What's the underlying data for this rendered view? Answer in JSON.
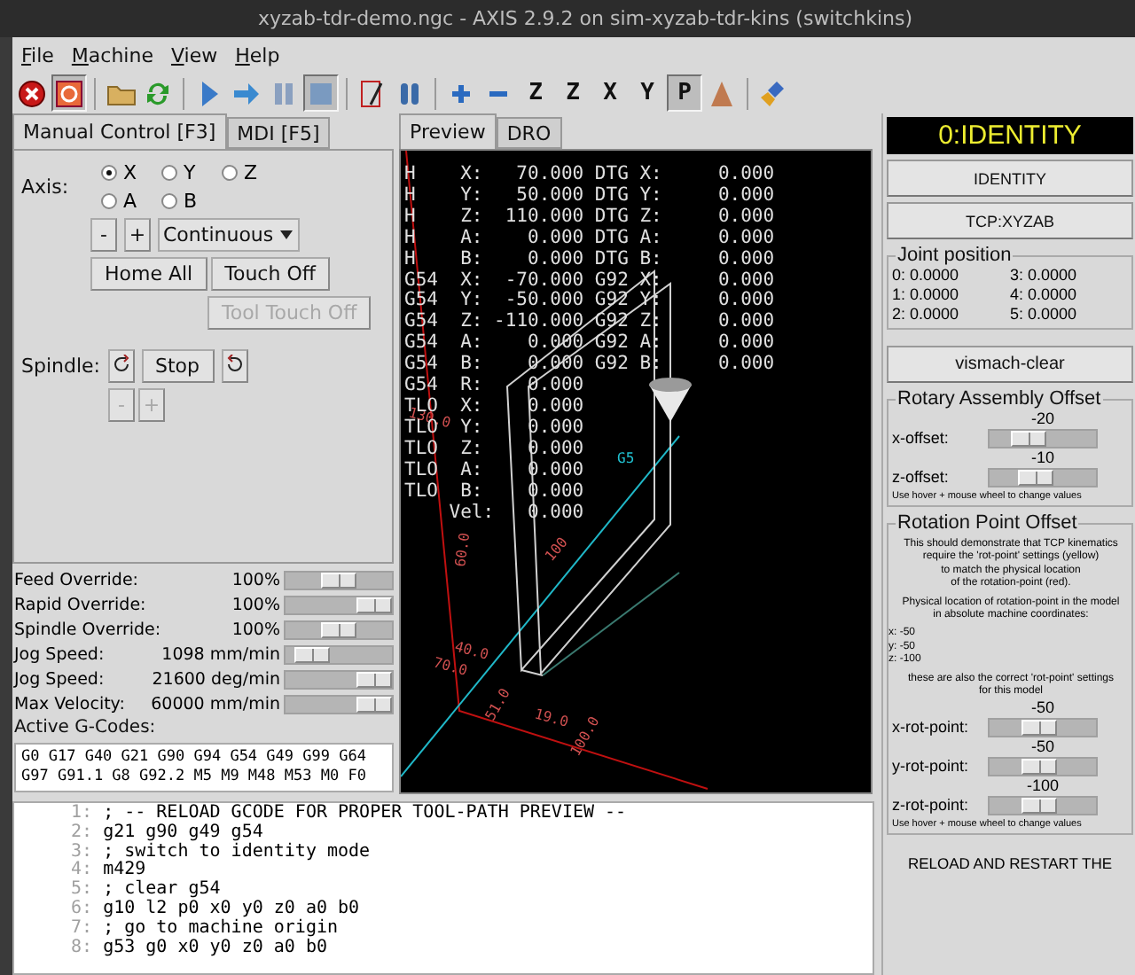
{
  "window": {
    "title": "xyzab-tdr-demo.ngc - AXIS 2.9.2 on sim-xyzab-tdr-kins (switchkins)"
  },
  "menu": [
    "File",
    "Machine",
    "View",
    "Help"
  ],
  "toolbar": [
    {
      "kind": "estop",
      "pressed": false
    },
    {
      "kind": "power",
      "pressed": true
    },
    {
      "kind": "sep"
    },
    {
      "kind": "open",
      "pressed": false
    },
    {
      "kind": "reload",
      "pressed": false
    },
    {
      "kind": "sep"
    },
    {
      "kind": "run",
      "pressed": false
    },
    {
      "kind": "step",
      "pressed": false
    },
    {
      "kind": "pause",
      "pressed": false
    },
    {
      "kind": "stop",
      "pressed": true
    },
    {
      "kind": "sep"
    },
    {
      "kind": "blockdelete",
      "pressed": false
    },
    {
      "kind": "optstop",
      "pressed": false
    },
    {
      "kind": "sep"
    },
    {
      "kind": "zoomin",
      "pressed": false
    },
    {
      "kind": "zoomout",
      "pressed": false
    },
    {
      "kind": "view",
      "label": "Z",
      "pressed": false
    },
    {
      "kind": "view",
      "label": "Z",
      "pressed": false
    },
    {
      "kind": "view",
      "label": "X",
      "pressed": false
    },
    {
      "kind": "view",
      "label": "Y",
      "pressed": false
    },
    {
      "kind": "view",
      "label": "P",
      "pressed": true
    },
    {
      "kind": "rotate",
      "pressed": false
    },
    {
      "kind": "sep"
    },
    {
      "kind": "clear",
      "pressed": false
    }
  ],
  "left_tabs": [
    {
      "label": "Manual Control [F3]",
      "selected": true
    },
    {
      "label": "MDI [F5]",
      "selected": false
    }
  ],
  "manual": {
    "axis_label": "Axis:",
    "axes": [
      {
        "label": "X",
        "selected": true
      },
      {
        "label": "Y",
        "selected": false
      },
      {
        "label": "Z",
        "selected": false
      },
      {
        "label": "A",
        "selected": false
      },
      {
        "label": "B",
        "selected": false
      }
    ],
    "jog_minus": "-",
    "jog_plus": "+",
    "jog_mode": "Continuous",
    "buttons": [
      {
        "label": "Home All",
        "disabled": false
      },
      {
        "label": "Touch Off",
        "disabled": false
      },
      {
        "label": "Tool Touch Off",
        "disabled": true
      }
    ],
    "spindle_label": "Spindle:",
    "spindle_stop": "Stop",
    "spindle_minus": {
      "label": "-",
      "disabled": true
    },
    "spindle_plus": {
      "label": "+",
      "disabled": true
    }
  },
  "overrides": [
    {
      "label": "Feed Override:",
      "reading": "100%",
      "level": 0.5
    },
    {
      "label": "Rapid Override:",
      "reading": "100%",
      "level": 1
    },
    {
      "label": "Spindle Override:",
      "reading": "100%",
      "level": 0.5
    },
    {
      "label": "Jog Speed:",
      "reading": "1098 mm/min",
      "level": 0.12
    },
    {
      "label": "Jog Speed:",
      "reading": "21600 deg/min",
      "level": 1
    },
    {
      "label": "Max Velocity:",
      "reading": "60000 mm/min",
      "level": 1
    }
  ],
  "active_gcodes": {
    "label": "Active G-Codes:",
    "lines": [
      "G0 G17 G40 G21 G90 G94 G54 G49 G99 G64",
      "G97 G91.1 G8 G92.2 M5 M9 M48 M53 M0 F0"
    ]
  },
  "preview_tabs": [
    {
      "label": "Preview",
      "selected": true
    },
    {
      "label": "DRO",
      "selected": false
    }
  ],
  "dro": [
    {
      "prefix": "H",
      "axis": "X:",
      "value": "70.000",
      "label2": "DTG X:",
      "value2": "0.000"
    },
    {
      "prefix": "H",
      "axis": "Y:",
      "value": "50.000",
      "label2": "DTG Y:",
      "value2": "0.000"
    },
    {
      "prefix": "H",
      "axis": "Z:",
      "value": "110.000",
      "label2": "DTG Z:",
      "value2": "0.000"
    },
    {
      "prefix": "H",
      "axis": "A:",
      "value": "0.000",
      "label2": "DTG A:",
      "value2": "0.000"
    },
    {
      "prefix": "H",
      "axis": "B:",
      "value": "0.000",
      "label2": "DTG B:",
      "value2": "0.000"
    },
    {
      "prefix": "G54",
      "axis": "X:",
      "value": "-70.000",
      "label2": "G92 X:",
      "value2": "0.000"
    },
    {
      "prefix": "G54",
      "axis": "Y:",
      "value": "-50.000",
      "label2": "G92 Y:",
      "value2": "0.000"
    },
    {
      "prefix": "G54",
      "axis": "Z:",
      "value": "-110.000",
      "label2": "G92 Z:",
      "value2": "0.000"
    },
    {
      "prefix": "G54",
      "axis": "A:",
      "value": "0.000",
      "label2": "G92 A:",
      "value2": "0.000"
    },
    {
      "prefix": "G54",
      "axis": "B:",
      "value": "0.000",
      "label2": "G92 B:",
      "value2": "0.000"
    },
    {
      "prefix": "G54",
      "axis": "R:",
      "value": "0.000"
    },
    {
      "prefix": "TLO",
      "axis": "X:",
      "value": "0.000"
    },
    {
      "prefix": "TLO",
      "axis": "Y:",
      "value": "0.000"
    },
    {
      "prefix": "TLO",
      "axis": "Z:",
      "value": "0.000"
    },
    {
      "prefix": "TLO",
      "axis": "A:",
      "value": "0.000"
    },
    {
      "prefix": "TLO",
      "axis": "B:",
      "value": "0.000"
    },
    {
      "axis": "Vel:",
      "value": "0.000"
    }
  ],
  "dimension_labels": [
    {
      "text": "130.0",
      "color": "#d05050"
    },
    {
      "text": "60.0",
      "color": "#d05050"
    },
    {
      "text": "100",
      "color": "#d05050"
    },
    {
      "text": "40.0",
      "color": "#d05050"
    },
    {
      "text": "70.0",
      "color": "#d05050"
    },
    {
      "text": "51.0",
      "color": "#d05050"
    },
    {
      "text": "19.0",
      "color": "#d05050"
    },
    {
      "text": "100.0",
      "color": "#d05050"
    },
    {
      "text": "G5",
      "color": "#20c0d0"
    }
  ],
  "gcode_lines": [
    {
      "number": "1:",
      "text": "; -- RELOAD GCODE FOR PROPER TOOL-PATH PREVIEW --"
    },
    {
      "number": "2:",
      "text": "g21 g90 g49 g54"
    },
    {
      "number": "3:",
      "text": "; switch to identity mode"
    },
    {
      "number": "4:",
      "text": "m429"
    },
    {
      "number": "5:",
      "text": "; clear g54"
    },
    {
      "number": "6:",
      "text": "g10 l2 p0 x0 y0 z0 a0 b0"
    },
    {
      "number": "7:",
      "text": "; go to machine origin"
    },
    {
      "number": "8:",
      "text": "g53 g0 x0 y0 z0 a0 b0"
    }
  ],
  "right": {
    "kins_title": "0:IDENTITY",
    "kins_buttons": [
      "IDENTITY",
      "TCP:XYZAB"
    ],
    "joint_position": {
      "title": "Joint position",
      "joints": [
        {
          "label": "0:",
          "value": "0.0000"
        },
        {
          "label": "3:",
          "value": "0.0000"
        },
        {
          "label": "1:",
          "value": "0.0000"
        },
        {
          "label": "4:",
          "value": "0.0000"
        },
        {
          "label": "2:",
          "value": "0.0000"
        },
        {
          "label": "5:",
          "value": "0.0000"
        }
      ]
    },
    "vismach_button": "vismach-clear",
    "rotary_offset": {
      "title": "Rotary Assembly Offset",
      "sliders": [
        {
          "label": "x-offset:",
          "reading": "-20",
          "level": 0.3
        },
        {
          "label": "z-offset:",
          "reading": "-10",
          "level": 0.4
        }
      ],
      "hint": "Use hover + mouse wheel to change values"
    },
    "rotation_point": {
      "title": "Rotation Point Offset",
      "description": "This should demonstrate that TCP kinematics\nrequire the 'rot-point' settings (yellow)\nto match the physical location\nof the rotation-point (red).",
      "physical": "Physical location of rotation-point in the model\nin absolute machine coordinates:",
      "coords": [
        "x: -50",
        "y: -50",
        "z: -100"
      ],
      "note": "these are also the correct 'rot-point' settings\nfor this model",
      "sliders": [
        {
          "label": "x-rot-point:",
          "reading": "-50",
          "level": 0.45
        },
        {
          "label": "y-rot-point:",
          "reading": "-50",
          "level": 0.45
        },
        {
          "label": "z-rot-point:",
          "reading": "-100",
          "level": 0.45
        }
      ],
      "hint": "Use hover + mouse wheel to change values"
    },
    "reload_notice": "RELOAD AND RESTART THE"
  }
}
